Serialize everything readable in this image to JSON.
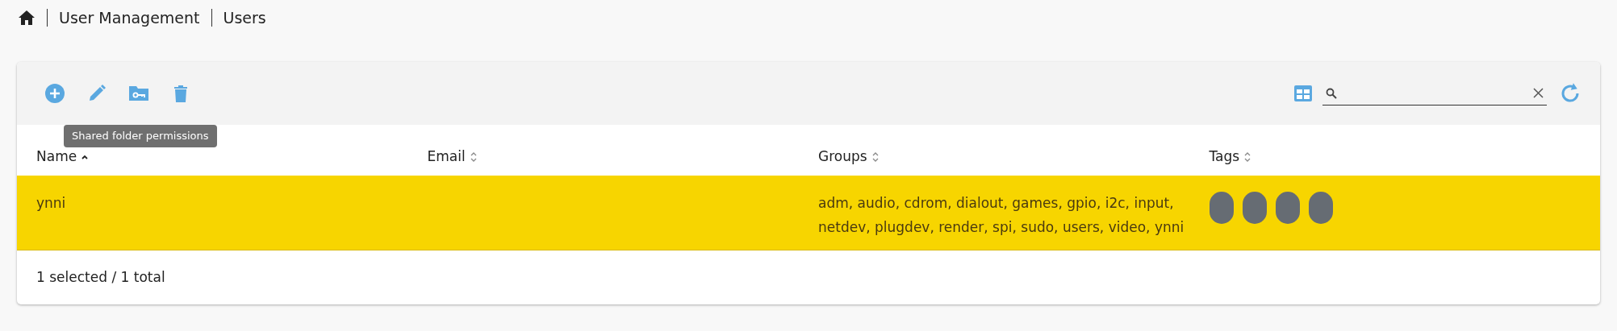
{
  "breadcrumb": [
    {
      "kind": "home"
    },
    {
      "kind": "text",
      "label": "User Management"
    },
    {
      "kind": "text",
      "label": "Users"
    }
  ],
  "toolbar": {
    "buttons": [
      {
        "kind": "add"
      },
      {
        "kind": "edit"
      },
      {
        "kind": "folder-key"
      },
      {
        "kind": "delete"
      }
    ],
    "tooltip": "Shared folder permissions"
  },
  "table": {
    "columns": [
      {
        "label": "Name",
        "sorted": true
      },
      {
        "label": "Email",
        "sorted": false
      },
      {
        "label": "Groups",
        "sorted": false
      },
      {
        "label": "Tags",
        "sorted": false
      }
    ],
    "rows": [
      {
        "selected": true,
        "name": "ynni",
        "groups": "adm, audio, cdrom, dialout, games, gpio, i2c, input, netdev, plugdev, render, spi, sudo, users, video, ynni",
        "tags": [
          {
            "kind": "chip"
          },
          {
            "kind": "chip"
          },
          {
            "kind": "chip"
          },
          {
            "kind": "chip"
          }
        ]
      }
    ]
  },
  "status_bar": "1 selected / 1 total"
}
